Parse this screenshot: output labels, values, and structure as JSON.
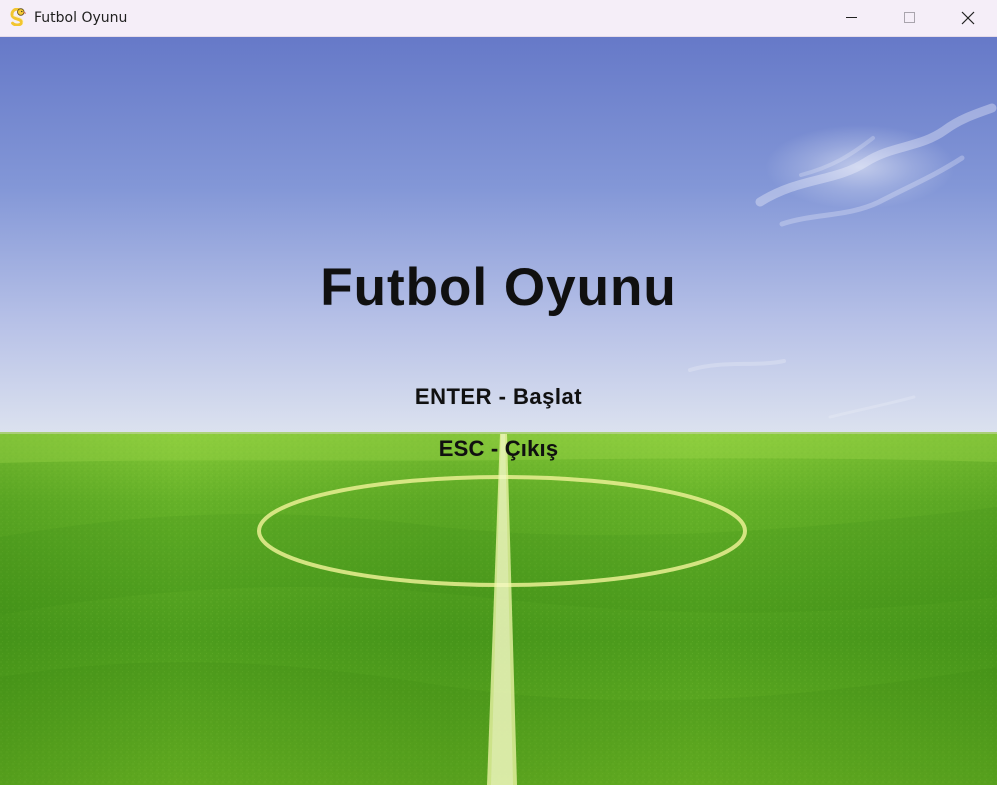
{
  "window": {
    "title": "Futbol Oyunu",
    "app_icon": "pygame-snake-icon",
    "controls": {
      "minimize_icon": "minimize-icon",
      "maximize_icon": "maximize-icon",
      "close_icon": "close-icon"
    }
  },
  "menu": {
    "title": "Futbol Oyunu",
    "start_hint": "ENTER - Başlat",
    "exit_hint": "ESC - Çıkış"
  },
  "colors": {
    "titlebar": "#f5eef8",
    "sky_top": "#6a7dcc",
    "sky_bottom": "#d8dfef",
    "grass_light": "#78bf28",
    "grass_dark": "#3f8f17",
    "field_line": "#e4eb8a",
    "menu_text": "#101010"
  }
}
